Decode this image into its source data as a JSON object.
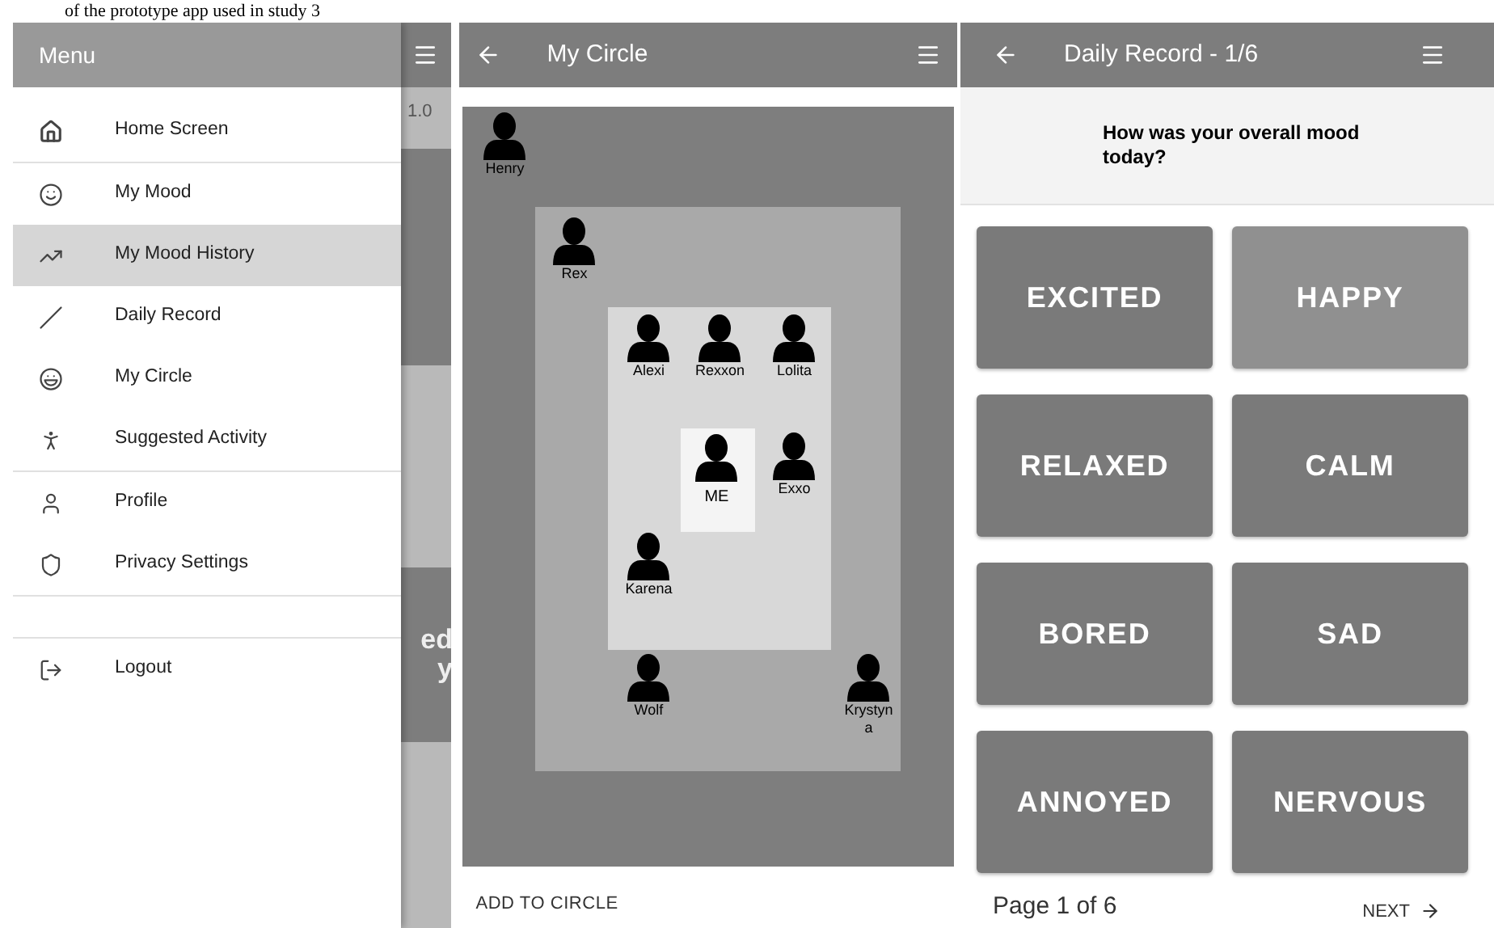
{
  "caption": "of the prototype app used in study 3",
  "home_screen": {
    "version": "1.0",
    "card_text": [
      "ed",
      "y"
    ]
  },
  "drawer": {
    "title": "Menu",
    "groups": [
      [
        {
          "label": "Home Screen",
          "selected": false
        }
      ],
      [
        {
          "label": "My Mood",
          "selected": false
        },
        {
          "label": "My Mood History",
          "selected": true
        },
        {
          "label": "Daily Record",
          "selected": false
        },
        {
          "label": "My Circle",
          "selected": false
        },
        {
          "label": "Suggested Activity",
          "selected": false
        }
      ],
      [
        {
          "label": "Profile",
          "selected": false
        },
        {
          "label": "Privacy Settings",
          "selected": false
        }
      ],
      [
        {
          "label": "Logout",
          "selected": false
        }
      ]
    ]
  },
  "circle_screen": {
    "title": "My Circle",
    "people": [
      {
        "name": "Henry"
      },
      {
        "name": "Rex"
      },
      {
        "name": "Alexi"
      },
      {
        "name": "Rexxon"
      },
      {
        "name": "Lolita"
      },
      {
        "name": "ME"
      },
      {
        "name": "Exxo"
      },
      {
        "name": "Karena"
      },
      {
        "name": "Wolf"
      },
      {
        "name": "Krystyna"
      }
    ],
    "action": "ADD TO CIRCLE"
  },
  "record_screen": {
    "title": "Daily Record - 1/6",
    "question": "How was your overall mood today?",
    "moods": [
      {
        "label": "EXCITED",
        "selected": false
      },
      {
        "label": "HAPPY",
        "selected": true
      },
      {
        "label": "RELAXED",
        "selected": false
      },
      {
        "label": "CALM",
        "selected": false
      },
      {
        "label": "BORED",
        "selected": false
      },
      {
        "label": "SAD",
        "selected": false
      },
      {
        "label": "ANNOYED",
        "selected": false
      },
      {
        "label": "NERVOUS",
        "selected": false
      }
    ],
    "page": "Page 1 of 6",
    "next": "NEXT"
  }
}
